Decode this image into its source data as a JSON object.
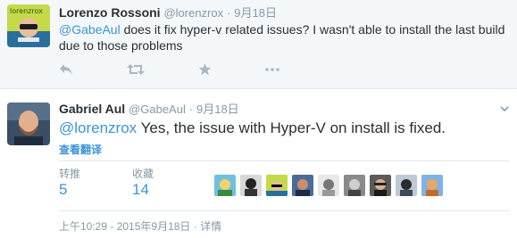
{
  "parent_tweet": {
    "name": "Lorenzo Rossoni",
    "handle": "@lorenzrox",
    "sep": "·",
    "time": "9月18日",
    "avatar_label": "lorenzrox",
    "mention": "@GabeAul",
    "text": " does it fix hyper-v related issues? I wasn't able to install the last build due to those problems"
  },
  "main_tweet": {
    "name": "Gabriel Aul",
    "handle": "@GabeAul",
    "sep": "·",
    "time": "9月18日",
    "mention": "@lorenzrox",
    "text": " Yes, the issue with Hyper-V on install is fixed.",
    "translate_label": "查看翻译",
    "retweets_label": "转推",
    "retweets_count": "5",
    "likes_label": "收藏",
    "likes_count": "14",
    "footer": "上午10:29 - 2015年9月18日 · 详情"
  },
  "colors": {
    "link": "#3b94d9",
    "muted": "#8899a6",
    "text": "#292f33"
  },
  "icons": [
    "reply-icon",
    "retweet-icon",
    "favorite-icon",
    "more-icon",
    "caret-down-icon"
  ]
}
